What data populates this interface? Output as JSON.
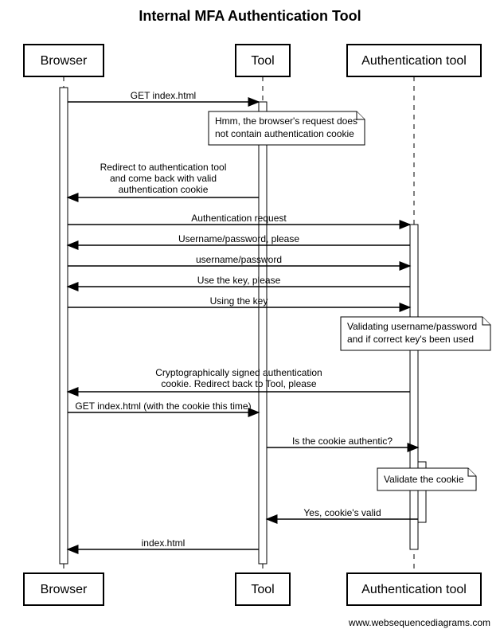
{
  "title": "Internal MFA Authentication Tool",
  "actors": {
    "browser": "Browser",
    "tool": "Tool",
    "auth": "Authentication tool"
  },
  "messages": {
    "m1": "GET index.html",
    "n1a": "Hmm, the browser's request does",
    "n1b": "not contain authentication cookie",
    "m2a": "Redirect to authentication tool",
    "m2b": "and come back with valid",
    "m2c": "authentication cookie",
    "m3": "Authentication request",
    "m4": "Username/password, please",
    "m5": "username/password",
    "m6": "Use the key, please",
    "m7": "Using the key",
    "n2a": "Validating username/password",
    "n2b": "and if correct key's been used",
    "m8a": "Cryptographically signed authentication",
    "m8b": "cookie. Redirect back to Tool, please",
    "m9": "GET index.html (with the cookie this time)",
    "m10": "Is the cookie authentic?",
    "n3": "Validate the cookie",
    "m11": "Yes, cookie's valid",
    "m12": "index.html"
  },
  "credit": "www.websequencediagrams.com"
}
